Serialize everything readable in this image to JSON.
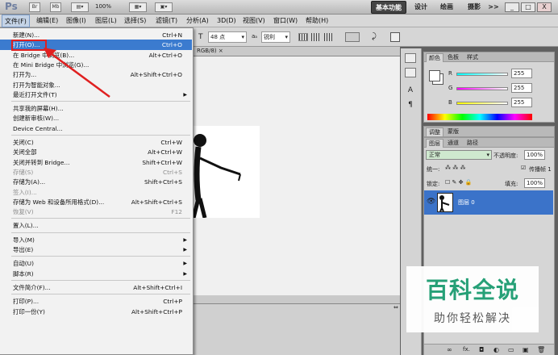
{
  "app": {
    "logo": "Ps",
    "zoom": "100%"
  },
  "workspaces": [
    "基本功能",
    "设计",
    "绘画",
    "摄影",
    ">>"
  ],
  "window_controls": [
    "_",
    "□",
    "X"
  ],
  "menubar": [
    "文件(F)",
    "编辑(E)",
    "图像(I)",
    "图层(L)",
    "选择(S)",
    "滤镜(T)",
    "分析(A)",
    "3D(D)",
    "视图(V)",
    "窗口(W)",
    "帮助(H)"
  ],
  "options": {
    "font_size": "48 点",
    "aa_label": "aₐ",
    "aa_value": "锐利"
  },
  "doc_tab": "RGB/8) ×",
  "file_menu": [
    {
      "label": "新建(N)...",
      "shortcut": "Ctrl+N"
    },
    {
      "label": "打开(O)...",
      "shortcut": "Ctrl+O",
      "selected": true
    },
    {
      "label": "在 Bridge 中浏览(B)...",
      "shortcut": "Alt+Ctrl+O"
    },
    {
      "label": "在 Mini Bridge 中浏览(G)...",
      "shortcut": ""
    },
    {
      "label": "打开为...",
      "shortcut": "Alt+Shift+Ctrl+O"
    },
    {
      "label": "打开为智能对象...",
      "shortcut": ""
    },
    {
      "label": "最近打开文件(T)",
      "shortcut": "",
      "submenu": true
    },
    {
      "sep": true
    },
    {
      "label": "共享我的屏幕(H)...",
      "shortcut": ""
    },
    {
      "label": "创建新审核(W)...",
      "shortcut": ""
    },
    {
      "label": "Device Central...",
      "shortcut": ""
    },
    {
      "sep": true
    },
    {
      "label": "关闭(C)",
      "shortcut": "Ctrl+W"
    },
    {
      "label": "关闭全部",
      "shortcut": "Alt+Ctrl+W"
    },
    {
      "label": "关闭并转到 Bridge...",
      "shortcut": "Shift+Ctrl+W"
    },
    {
      "label": "存储(S)",
      "shortcut": "Ctrl+S",
      "disabled": true
    },
    {
      "label": "存储为(A)...",
      "shortcut": "Shift+Ctrl+S"
    },
    {
      "label": "签入(I)...",
      "shortcut": "",
      "disabled": true
    },
    {
      "label": "存储为 Web 和设备所用格式(D)...",
      "shortcut": "Alt+Shift+Ctrl+S"
    },
    {
      "label": "恢复(V)",
      "shortcut": "F12",
      "disabled": true
    },
    {
      "sep": true
    },
    {
      "label": "置入(L)...",
      "shortcut": ""
    },
    {
      "sep": true
    },
    {
      "label": "导入(M)",
      "shortcut": "",
      "submenu": true
    },
    {
      "label": "导出(E)",
      "shortcut": "",
      "submenu": true
    },
    {
      "sep": true
    },
    {
      "label": "自动(U)",
      "shortcut": "",
      "submenu": true
    },
    {
      "label": "脚本(R)",
      "shortcut": "",
      "submenu": true
    },
    {
      "sep": true
    },
    {
      "label": "文件简介(F)...",
      "shortcut": "Alt+Shift+Ctrl+I"
    },
    {
      "sep": true
    },
    {
      "label": "打印(P)...",
      "shortcut": "Ctrl+P"
    },
    {
      "label": "打印一份(Y)",
      "shortcut": "Alt+Shift+Ctrl+P"
    }
  ],
  "color_panel": {
    "tabs": [
      "颜色",
      "色板",
      "样式"
    ],
    "channels": [
      {
        "name": "R",
        "value": "255"
      },
      {
        "name": "G",
        "value": "255"
      },
      {
        "name": "B",
        "value": "255"
      }
    ]
  },
  "adjust_tabs": [
    "调整",
    "蒙版"
  ],
  "layers_panel": {
    "tabs": [
      "图层",
      "通道",
      "路径"
    ],
    "blend_mode": "正常",
    "opacity_label": "不透明度:",
    "opacity": "100%",
    "unify_label": "统一:",
    "propagate_label": "传播帧 1",
    "lock_label": "锁定:",
    "fill_label": "填充:",
    "fill": "100%",
    "layer_name": "图层 0"
  },
  "watermark": {
    "title": "百科全说",
    "subtitle": "助你轻松解决"
  },
  "colors": {
    "selection": "#3b7bcf",
    "highlight_box": "#e02020",
    "layer_selected": "#3b73c9",
    "watermark_title": "#1f9e74"
  }
}
